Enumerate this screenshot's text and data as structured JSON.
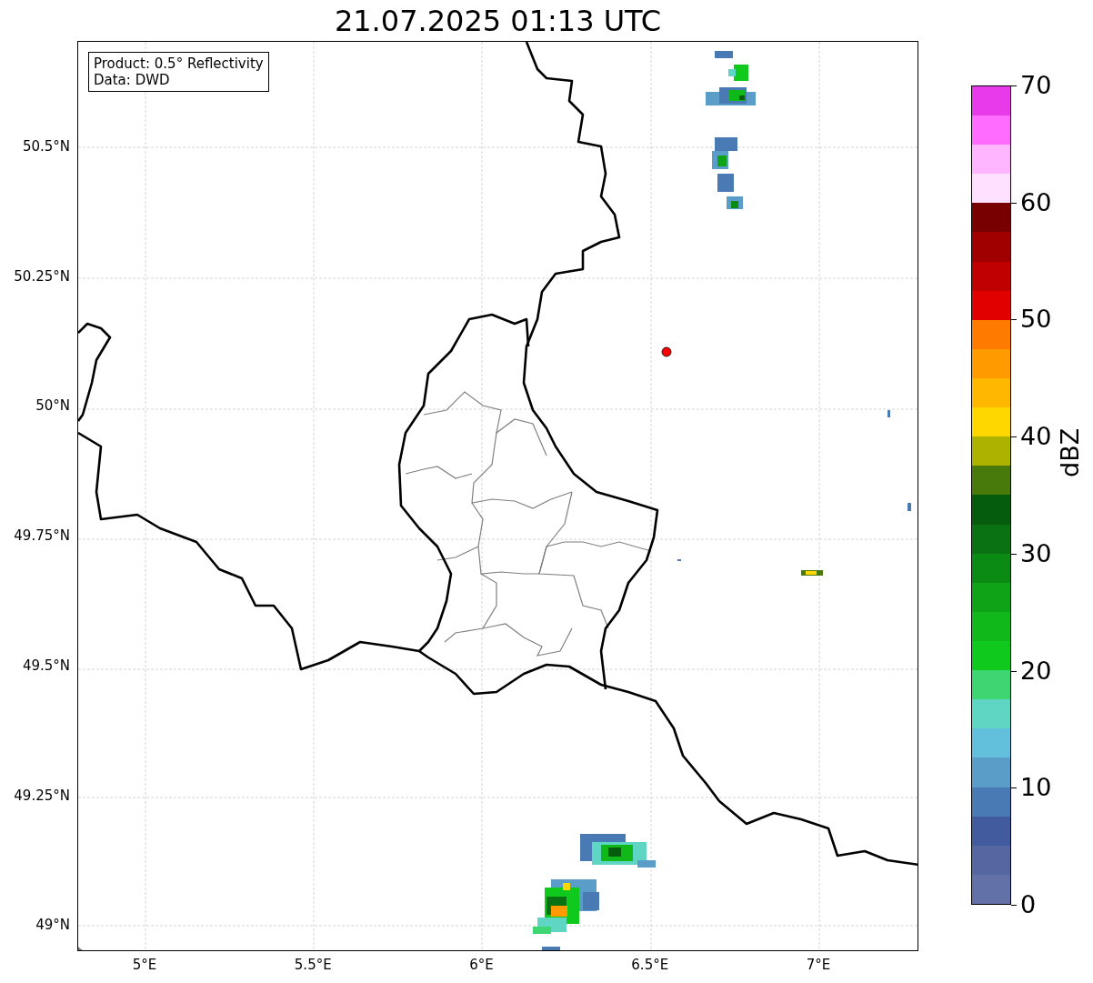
{
  "title": "21.07.2025 01:13 UTC",
  "legend": [
    "Product: 0.5° Reflectivity",
    "Data: DWD"
  ],
  "map": {
    "y_ticks": [
      "50.5°N",
      "50.25°N",
      "50°N",
      "49.75°N",
      "49.5°N",
      "49.25°N",
      "49°N"
    ],
    "x_ticks": [
      "5°E",
      "5.5°E",
      "6°E",
      "6.5°E",
      "7°E"
    ]
  },
  "colorbar": {
    "label": "dBZ",
    "ticks": [
      "70",
      "60",
      "50",
      "40",
      "30",
      "20",
      "10",
      "0"
    ],
    "segments": [
      {
        "color": "#6272a8"
      },
      {
        "color": "#5467a0"
      },
      {
        "color": "#425b9e"
      },
      {
        "color": "#4a7ab3"
      },
      {
        "color": "#5a9dc8"
      },
      {
        "color": "#63c0dd"
      },
      {
        "color": "#5fd6c4"
      },
      {
        "color": "#3dd672"
      },
      {
        "color": "#10c91d"
      },
      {
        "color": "#10b81a"
      },
      {
        "color": "#0fa317"
      },
      {
        "color": "#0c8b14"
      },
      {
        "color": "#0a7212"
      },
      {
        "color": "#065c0d"
      },
      {
        "color": "#477a0b"
      },
      {
        "color": "#adb100"
      },
      {
        "color": "#ffd700"
      },
      {
        "color": "#ffb700"
      },
      {
        "color": "#ff9b00"
      },
      {
        "color": "#ff7b00"
      },
      {
        "color": "#e00000"
      },
      {
        "color": "#c00000"
      },
      {
        "color": "#a00000"
      },
      {
        "color": "#780000"
      },
      {
        "color": "#ffe0ff"
      },
      {
        "color": "#ffb6ff"
      },
      {
        "color": "#ff6cff"
      },
      {
        "color": "#e83ae8"
      }
    ]
  }
}
